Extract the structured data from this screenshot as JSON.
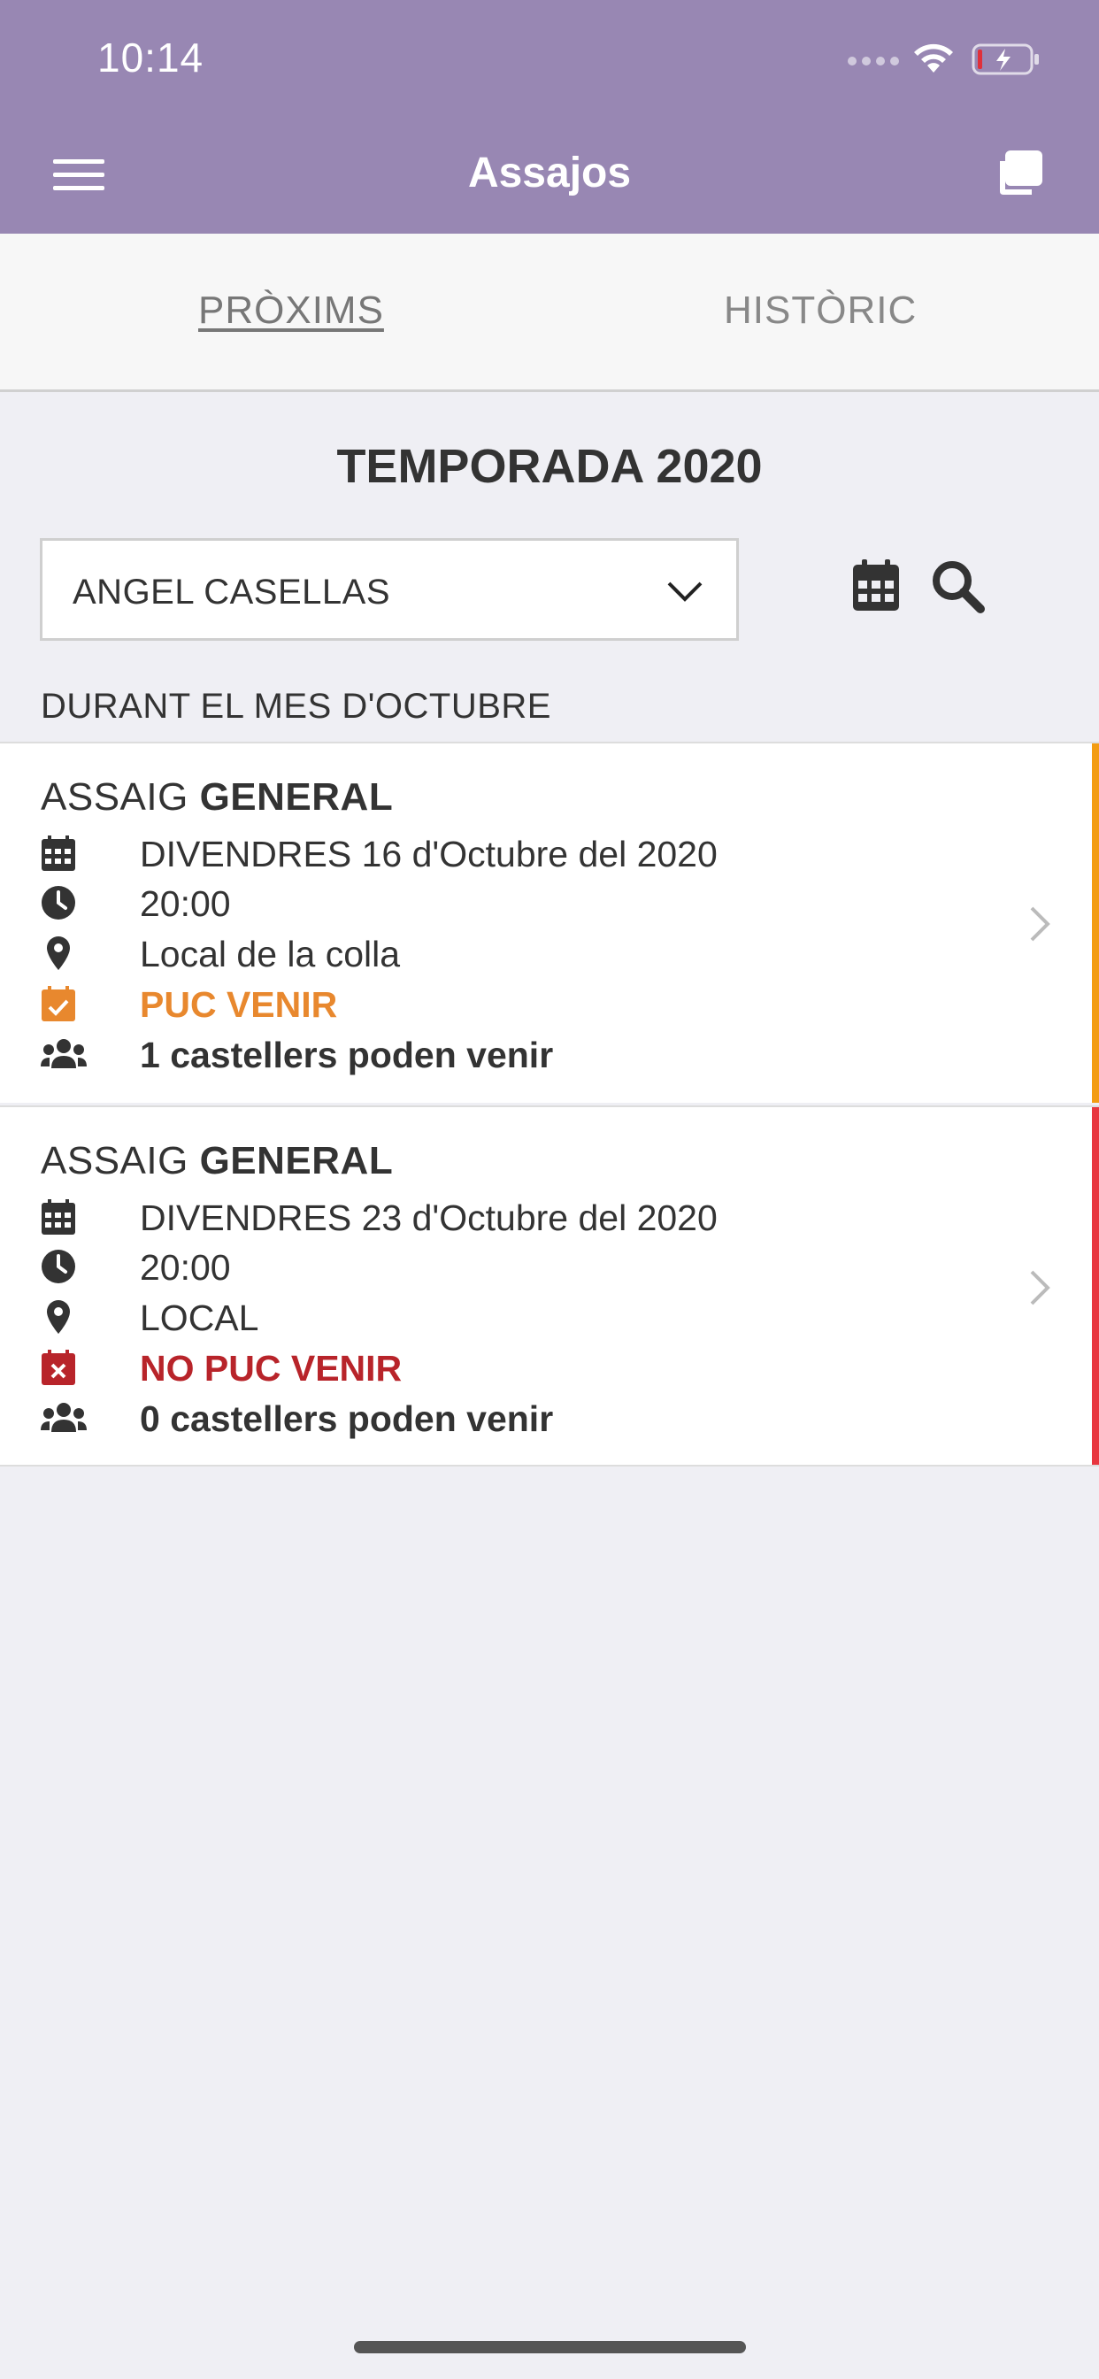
{
  "status_bar": {
    "time": "10:14"
  },
  "nav": {
    "title": "Assajos"
  },
  "tabs": [
    {
      "label": "PRÒXIMS",
      "active": true
    },
    {
      "label": "HISTÒRIC",
      "active": false
    }
  ],
  "season": {
    "title": "TEMPORADA 2020"
  },
  "filter": {
    "selected": "ANGEL CASELLAS"
  },
  "month_header": "DURANT EL MES D'OCTUBRE",
  "events": [
    {
      "title_prefix": "ASSAIG ",
      "title_bold": "GENERAL",
      "date": "DIVENDRES 16 d'Octubre del 2020",
      "time": "20:00",
      "location": "Local de la colla",
      "attendance": "PUC VENIR",
      "attendance_color": "#e8882e",
      "count": "1 castellers poden venir",
      "accent_color": "#f39c12"
    },
    {
      "title_prefix": "ASSAIG ",
      "title_bold": "GENERAL",
      "date": "DIVENDRES 23 d'Octubre del 2020",
      "time": "20:00",
      "location": "LOCAL",
      "attendance": "NO PUC VENIR",
      "attendance_color": "#b8242a",
      "count": "0 castellers poden venir",
      "accent_color": "#e8363f"
    }
  ],
  "colors": {
    "header": "#9887b3",
    "background": "#efeff4"
  }
}
